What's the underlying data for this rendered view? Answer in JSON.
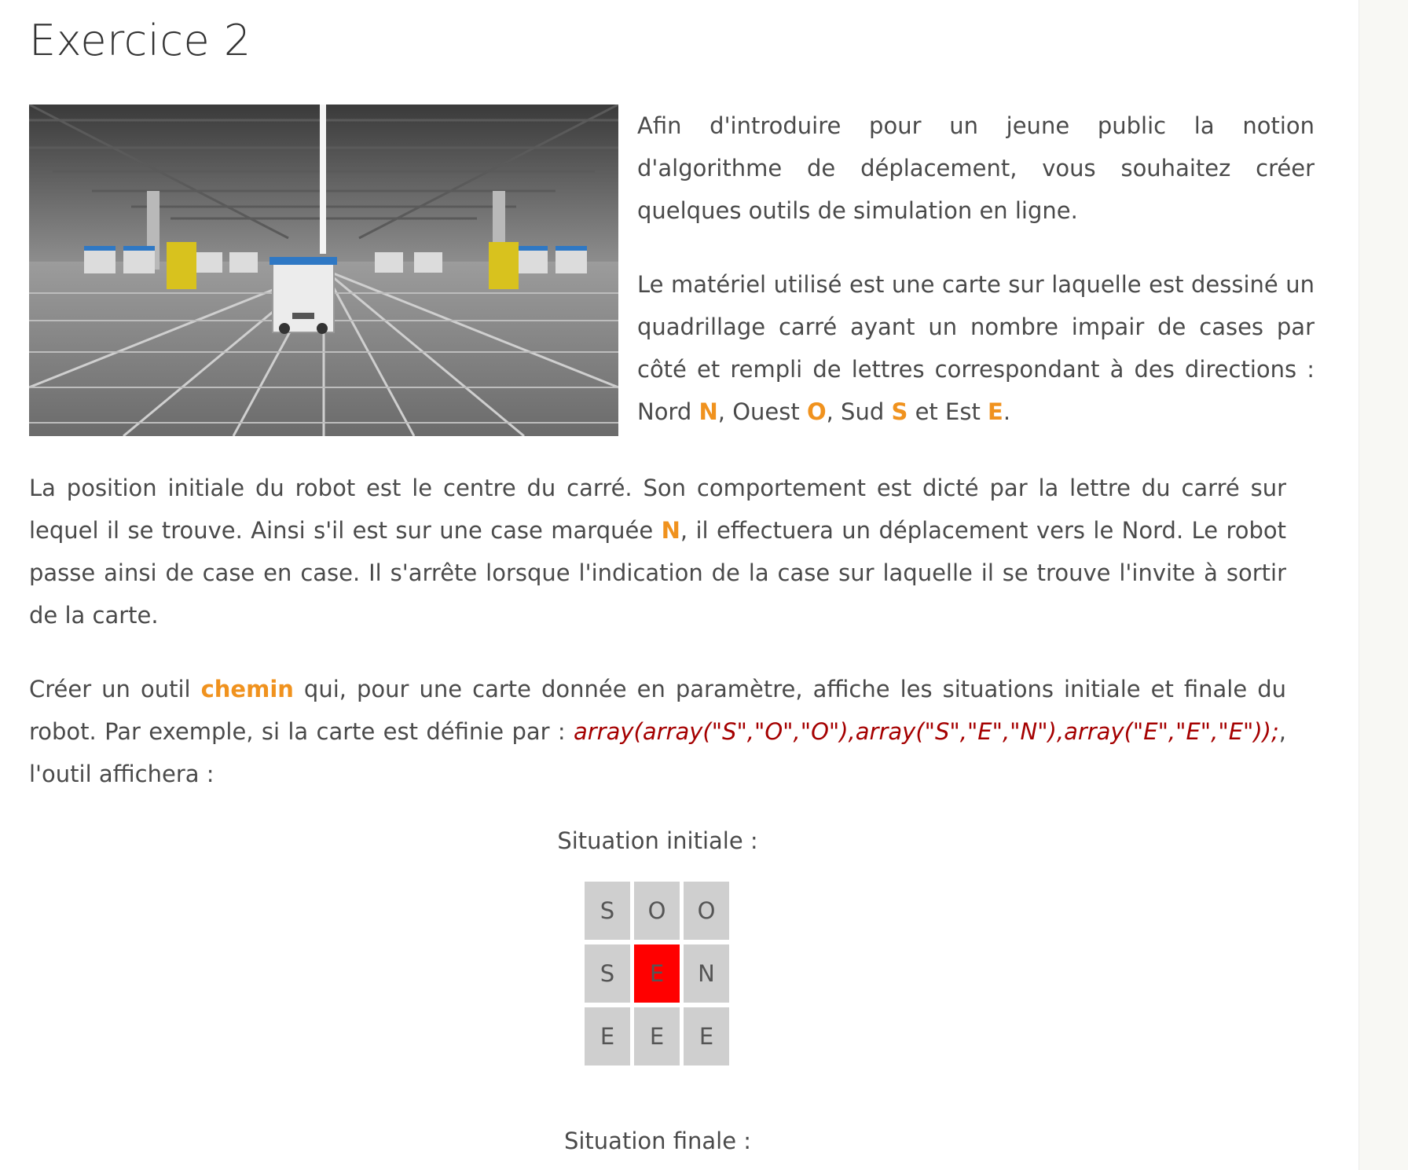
{
  "title": "Exercice 2",
  "intro_paragraph_1": "Afin d'introduire pour un jeune public la notion d'algorithme de déplacement, vous souhaitez créer quelques outils de simulation en ligne.",
  "intro_paragraph_2": {
    "text_before": "Le matériel utilisé est une carte sur laquelle est dessiné un quadrillage carré ayant un nombre impair de cases par côté et rempli de lettres correspondant à des directions : Nord ",
    "letter_n": "N",
    "sep_1": ", Ouest ",
    "letter_o": "O",
    "sep_2": ", Sud ",
    "letter_s": "S",
    "sep_3": " et Est ",
    "letter_e": "E",
    "end": "."
  },
  "paragraph_3": {
    "text_before": "La position initiale du robot est le centre du carré. Son comportement est dicté par la lettre du carré sur lequel il se trouve. Ainsi s'il est sur une case marquée ",
    "letter_n": "N",
    "text_after": ", il effectuera un déplacement vers le Nord. Le robot passe ainsi de case en case. Il s'arrête lorsque l'indication de la case sur laquelle il se trouve l'invite à sortir de la carte."
  },
  "paragraph_4": {
    "text_before": "Créer un outil ",
    "tool_name": "chemin",
    "text_middle": " qui, pour une carte donnée en paramètre, affiche les situations initiale et finale du robot. Par exemple, si la carte est définie par : ",
    "code": "array(array(\"S\",\"O\",\"O\"),array(\"S\",\"E\",\"N\"),array(\"E\",\"E\",\"E\"));",
    "text_after": ", l'outil affichera :"
  },
  "situation_initiale_label": "Situation initiale :",
  "grid": [
    [
      "S",
      "O",
      "O"
    ],
    [
      "S",
      "E",
      "N"
    ],
    [
      "E",
      "E",
      "E"
    ]
  ],
  "robot_cell": "E",
  "situation_finale_label": "Situation finale :",
  "colors": {
    "highlight": "#f0921e",
    "code": "#a50000",
    "robot": "#ff0000",
    "cell": "#cfcfcf"
  }
}
